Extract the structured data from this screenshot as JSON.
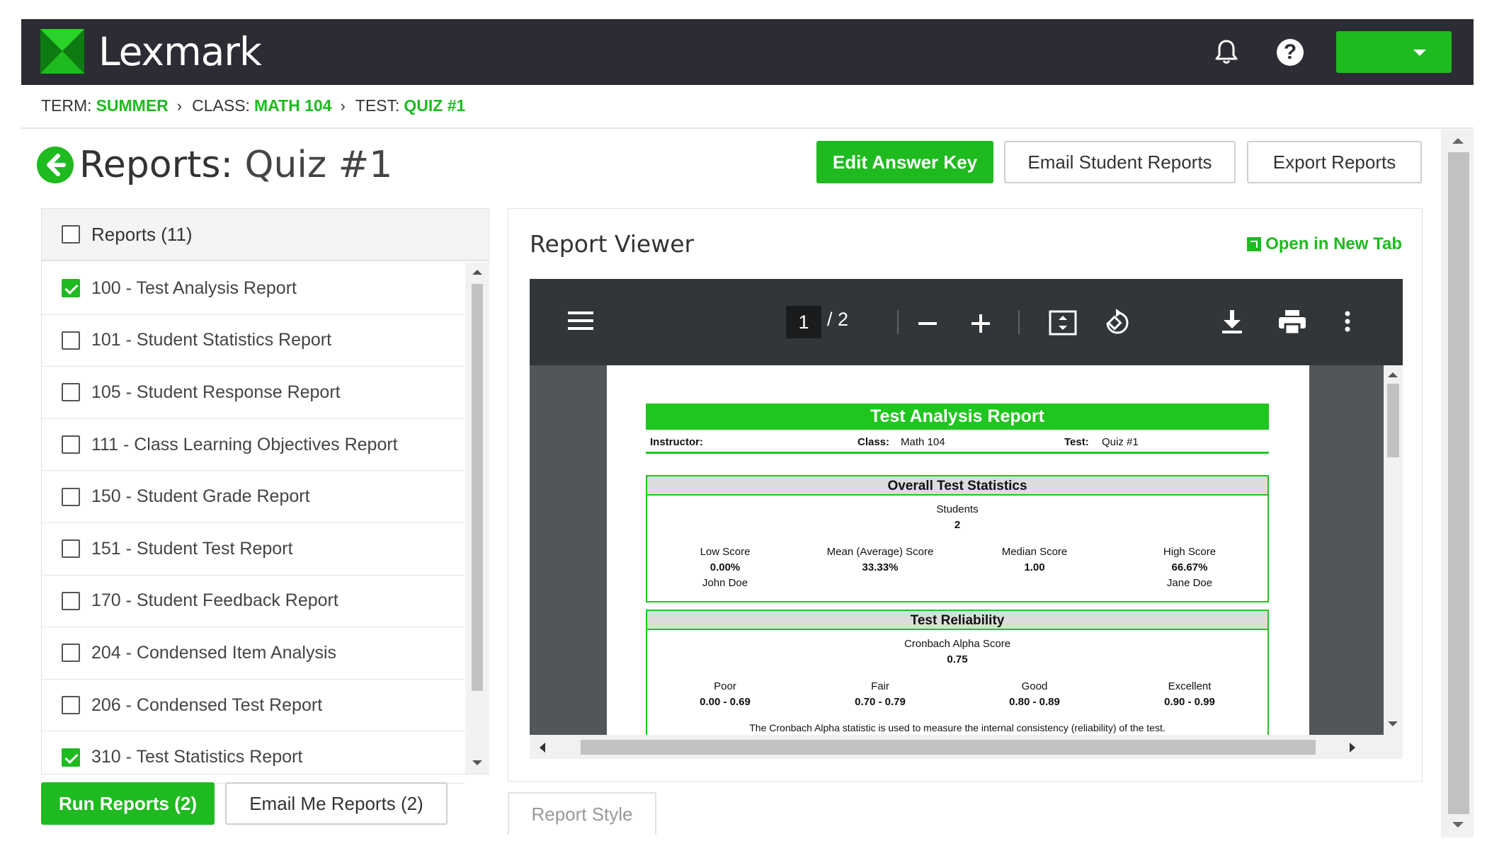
{
  "header": {
    "brand": "Lexmark",
    "colors": {
      "bar": "#2c2c35",
      "accent": "#1fba1f"
    }
  },
  "breadcrumb": [
    {
      "label": "TERM:",
      "value": "SUMMER"
    },
    {
      "label": "CLASS:",
      "value": "MATH 104"
    },
    {
      "label": "TEST:",
      "value": "QUIZ #1"
    }
  ],
  "page": {
    "title": "Reports:",
    "subtitle": "Quiz #1",
    "edit_answer_key": "Edit Answer Key",
    "email_student_reports": "Email Student Reports",
    "export_reports": "Export Reports"
  },
  "reports": {
    "header": "Reports (11)",
    "header_checked": false,
    "items": [
      {
        "label": "100 - Test Analysis Report",
        "checked": true
      },
      {
        "label": "101 - Student Statistics Report",
        "checked": false
      },
      {
        "label": "105 - Student Response Report",
        "checked": false
      },
      {
        "label": "111 - Class Learning Objectives Report",
        "checked": false
      },
      {
        "label": "150 - Student Grade Report",
        "checked": false
      },
      {
        "label": "151 - Student Test Report",
        "checked": false
      },
      {
        "label": "170 - Student Feedback Report",
        "checked": false
      },
      {
        "label": "204 - Condensed Item Analysis",
        "checked": false
      },
      {
        "label": "206 - Condensed Test Report",
        "checked": false
      },
      {
        "label": "310 - Test Statistics Report",
        "checked": true
      }
    ],
    "run_button": "Run Reports (2)",
    "email_me_button": "Email Me Reports (2)"
  },
  "viewer": {
    "title": "Report Viewer",
    "open_new_tab": "Open in New Tab",
    "current_page": "1",
    "total_pages": "/  2",
    "report": {
      "title": "Test Analysis Report",
      "instructor_label": "Instructor:",
      "class_label": "Class:",
      "class_value": "Math 104",
      "test_label": "Test:",
      "test_value": "Quiz #1",
      "overall": {
        "title": "Overall Test Statistics",
        "students_label": "Students",
        "students_value": "2",
        "low_label": "Low Score",
        "low_value": "0.00%",
        "low_name": "John Doe",
        "mean_label": "Mean (Average) Score",
        "mean_value": "33.33%",
        "median_label": "Median Score",
        "median_value": "1.00",
        "high_label": "High Score",
        "high_value": "66.67%",
        "high_name": "Jane Doe"
      },
      "reliability": {
        "title": "Test Reliability",
        "cronbach_label": "Cronbach Alpha Score",
        "cronbach_value": "0.75",
        "poor_label": "Poor",
        "poor_range": "0.00 - 0.69",
        "fair_label": "Fair",
        "fair_range": "0.70 - 0.79",
        "good_label": "Good",
        "good_range": "0.80 - 0.89",
        "excellent_label": "Excellent",
        "excellent_range": "0.90 - 0.99",
        "note": "The Cronbach Alpha statistic is used to measure the internal consistency (reliability) of the test."
      }
    }
  },
  "report_style_tab": "Report Style"
}
